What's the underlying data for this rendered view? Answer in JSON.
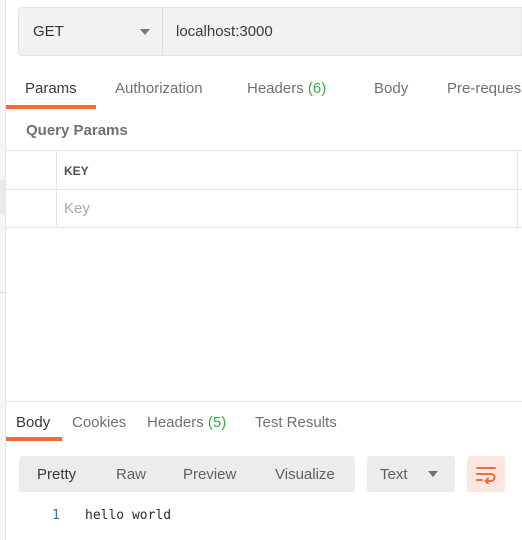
{
  "request": {
    "method": "GET",
    "url": "localhost:3000",
    "tabs": [
      {
        "label": "Params"
      },
      {
        "label": "Authorization"
      },
      {
        "label": "Headers",
        "count": "(6)"
      },
      {
        "label": "Body"
      },
      {
        "label": "Pre-reques"
      }
    ]
  },
  "query_params": {
    "title": "Query Params",
    "key_header": "KEY",
    "key_placeholder": "Key"
  },
  "response": {
    "tabs": [
      {
        "label": "Body"
      },
      {
        "label": "Cookies"
      },
      {
        "label": "Headers",
        "count": "(5)"
      },
      {
        "label": "Test Results"
      }
    ],
    "view_modes": [
      "Pretty",
      "Raw",
      "Preview",
      "Visualize"
    ],
    "format": "Text",
    "code": [
      {
        "line": "1",
        "text": "hello world"
      }
    ]
  },
  "colors": {
    "accent": "#f26b3a",
    "count_green": "#38a84a"
  },
  "icons": {
    "wrap": "wrap-lines-icon"
  }
}
